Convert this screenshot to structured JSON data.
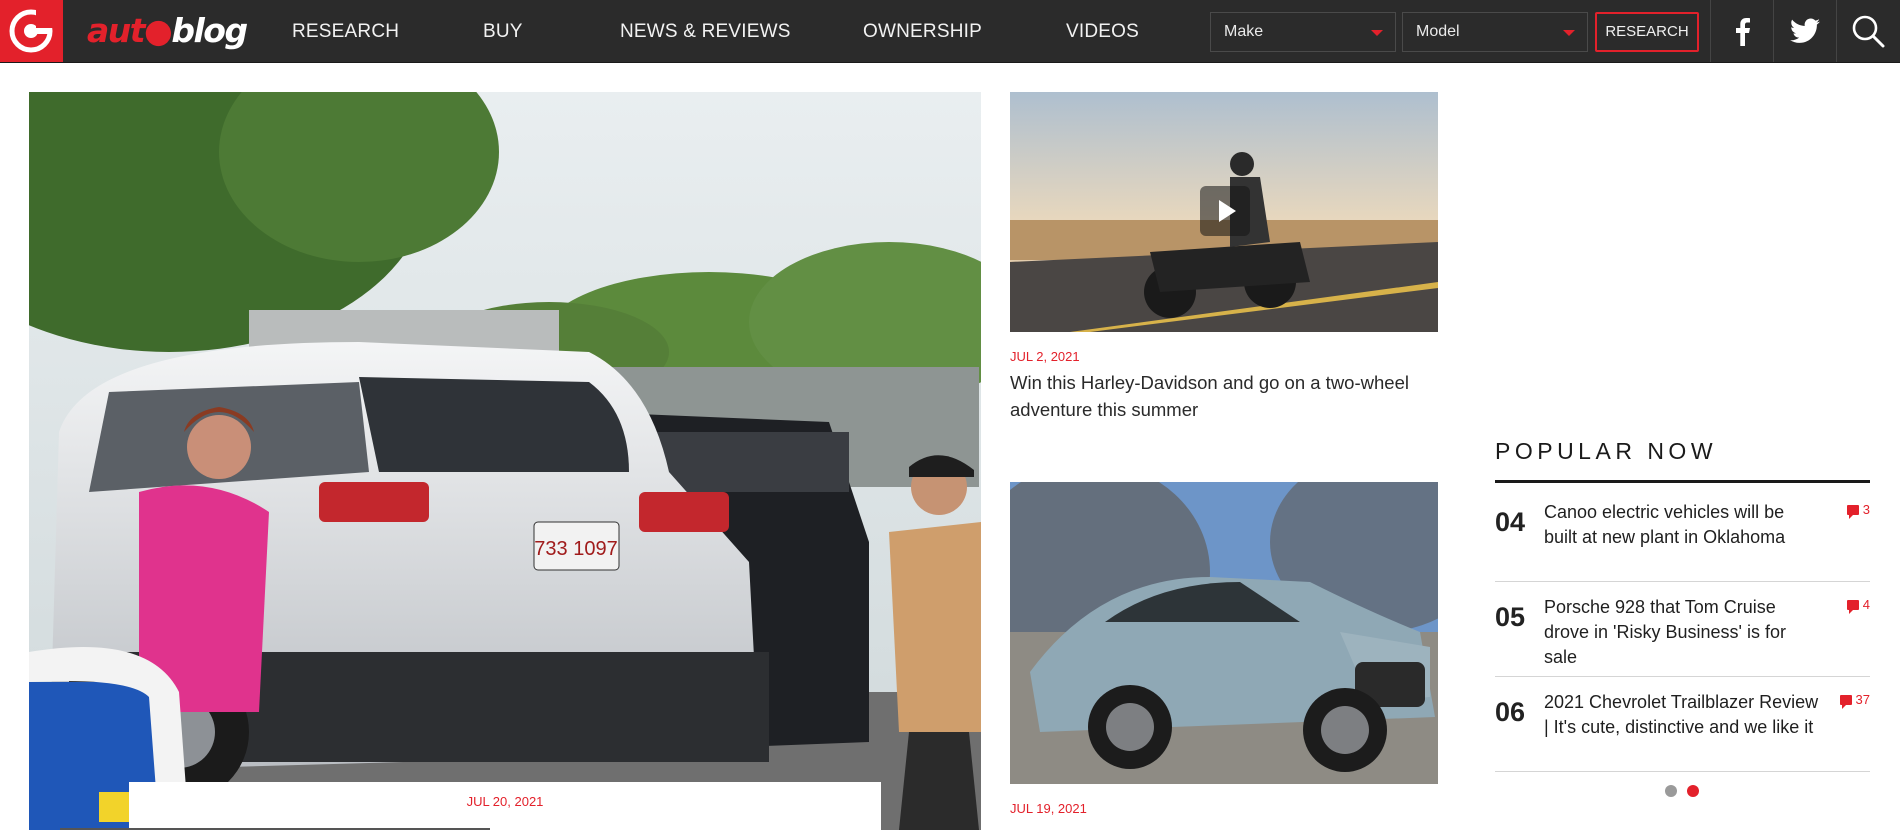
{
  "brand": {
    "name_part1": "aut",
    "name_part2": "blog",
    "accent_color": "#e3212b",
    "logo_icon": "autoblog-logo-icon"
  },
  "nav": {
    "menu": [
      "RESEARCH",
      "BUY",
      "NEWS & REVIEWS",
      "OWNERSHIP",
      "VIDEOS"
    ],
    "make_select": {
      "value": "Make"
    },
    "model_select": {
      "value": "Model"
    },
    "research_button": "RESEARCH",
    "social_icons": [
      "facebook-icon",
      "twitter-icon",
      "search-icon"
    ]
  },
  "hero": {
    "image": "photo of people refueling cars at a gas station",
    "date": "JUL 20, 2021"
  },
  "articles": [
    {
      "date": "JUL 2, 2021",
      "title": "Win this Harley-Davidson and go on a two-wheel adventure this summer",
      "has_video": true
    },
    {
      "date": "JUL 19, 2021",
      "title": ""
    }
  ],
  "popular": {
    "heading": "POPULAR NOW",
    "items": [
      {
        "num": "04",
        "title": "Canoo electric vehicles will be built at new plant in Oklahoma",
        "comments": "3"
      },
      {
        "num": "05",
        "title": "Porsche 928 that Tom Cruise drove in 'Risky Business' is for sale",
        "comments": "4"
      },
      {
        "num": "06",
        "title": "2021 Chevrolet Trailblazer Review | It's cute, distinctive and we like it",
        "comments": "37"
      }
    ],
    "pagination": {
      "pages": 2,
      "active": 2
    }
  }
}
